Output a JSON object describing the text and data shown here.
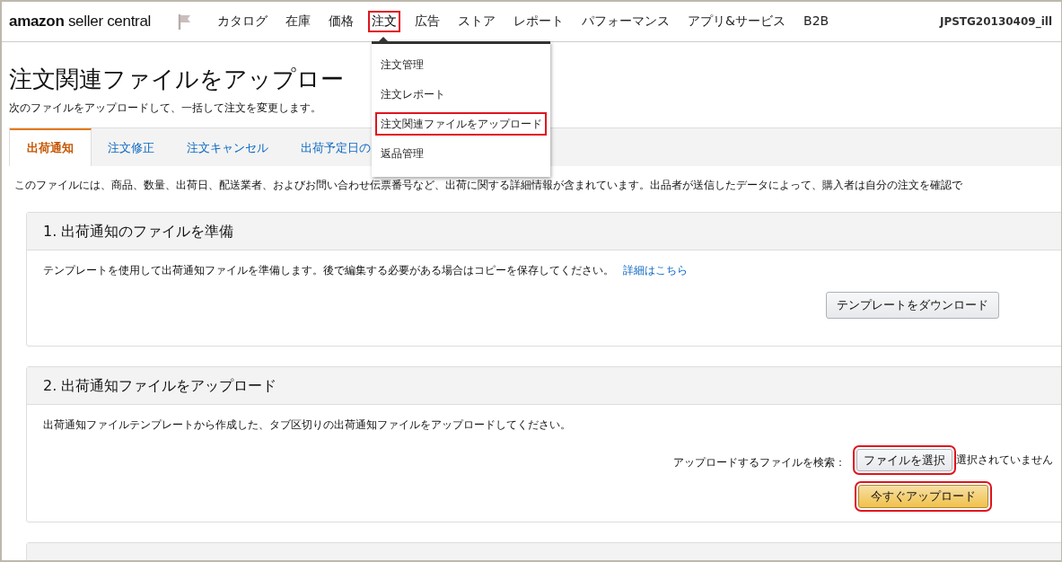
{
  "header": {
    "logo": "amazon seller central",
    "nav": [
      {
        "label": "カタログ",
        "selected": false,
        "highlighted": false
      },
      {
        "label": "在庫",
        "selected": false,
        "highlighted": false
      },
      {
        "label": "価格",
        "selected": false,
        "highlighted": false
      },
      {
        "label": "注文",
        "selected": true,
        "highlighted": true
      },
      {
        "label": "広告",
        "selected": false,
        "highlighted": false
      },
      {
        "label": "ストア",
        "selected": false,
        "highlighted": false
      },
      {
        "label": "レポート",
        "selected": false,
        "highlighted": false
      },
      {
        "label": "パフォーマンス",
        "selected": false,
        "highlighted": false
      },
      {
        "label": "アプリ&サービス",
        "selected": false,
        "highlighted": false
      },
      {
        "label": "B2B",
        "selected": false,
        "highlighted": false
      }
    ],
    "account": "JPSTG20130409_ill"
  },
  "dropdown": {
    "items": [
      {
        "label": "注文管理",
        "highlighted": false
      },
      {
        "label": "注文レポート",
        "highlighted": false
      },
      {
        "label": "注文関連ファイルをアップロード",
        "highlighted": true
      },
      {
        "label": "返品管理",
        "highlighted": false
      }
    ]
  },
  "page": {
    "title": "注文関連ファイルをアップロー",
    "subtitle": "次のファイルをアップロードして、一括して注文を変更します。"
  },
  "tabs": [
    {
      "label": "出荷通知",
      "selected": true
    },
    {
      "label": "注文修正",
      "selected": false
    },
    {
      "label": "注文キャンセル",
      "selected": false
    },
    {
      "label": "出荷予定日の",
      "selected": false
    }
  ],
  "description": "このファイルには、商品、数量、出荷日、配送業者、およびお問い合わせ伝票番号など、出荷に関する詳細情報が含まれています。出品者が送信したデータによって、購入者は自分の注文を確認で",
  "sections": [
    {
      "kind": "download",
      "title": "1. 出荷通知のファイルを準備",
      "text": "テンプレートを使用して出荷通知ファイルを準備します。後で編集する必要がある場合はコピーを保存してください。",
      "link": "詳細はこちら",
      "button": {
        "label": "テンプレートをダウンロード",
        "highlighted": false
      }
    },
    {
      "kind": "upload",
      "title": "2. 出荷通知ファイルをアップロード",
      "text": "出荷通知ファイルテンプレートから作成した、タブ区切りの出荷通知ファイルをアップロードしてください。",
      "file_label": "アップロードするファイルを検索：",
      "file_button": {
        "label": "ファイルを選択",
        "highlighted": true
      },
      "file_status": "選択されていません",
      "button": {
        "label": "今すぐアップロード",
        "highlighted": true
      }
    },
    {
      "kind": "collapsed"
    }
  ]
}
